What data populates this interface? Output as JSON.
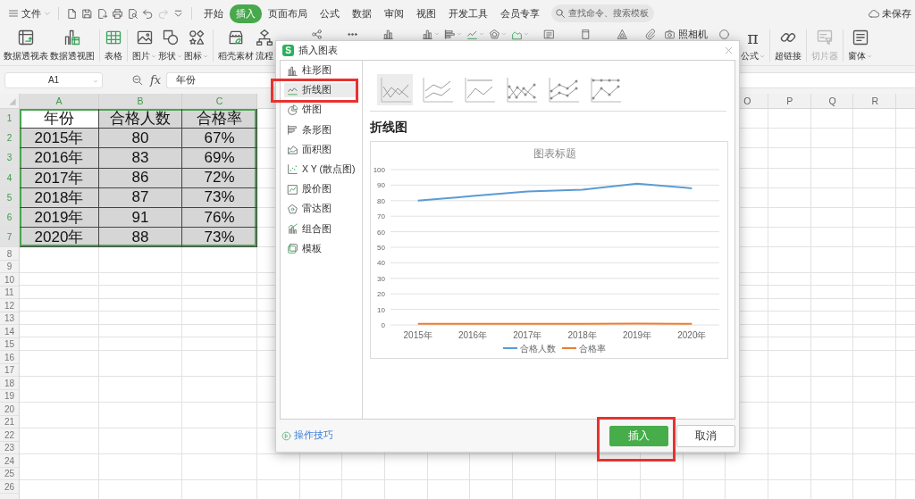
{
  "topbar": {
    "menu_label": "文件",
    "quick_access": [
      {
        "disabled": false
      },
      {
        "disabled": false
      },
      {
        "disabled": false
      },
      {
        "disabled": false
      },
      {
        "disabled": false
      },
      {
        "disabled": false
      },
      {
        "disabled": true
      },
      {
        "disabled": false
      }
    ],
    "tabs": [
      {
        "label": "开始",
        "selected": false
      },
      {
        "label": "插入",
        "selected": true
      },
      {
        "label": "页面布局",
        "selected": false
      },
      {
        "label": "公式",
        "selected": false
      },
      {
        "label": "数据",
        "selected": false
      },
      {
        "label": "审阅",
        "selected": false
      },
      {
        "label": "视图",
        "selected": false
      },
      {
        "label": "开发工具",
        "selected": false
      },
      {
        "label": "会员专享",
        "selected": false
      }
    ],
    "search": {
      "placeholder": "查找命令、搜索模板"
    },
    "save_status": "未保存"
  },
  "ribbon": {
    "tools_left": [
      {
        "label": "数据透视表",
        "dropdown": false
      },
      {
        "label": "数据透视图",
        "dropdown": false
      },
      {
        "label": "表格",
        "dropdown": false
      },
      {
        "label": "图片",
        "dropdown": true
      },
      {
        "label": "形状",
        "dropdown": true
      },
      {
        "label": "图标",
        "dropdown": true
      },
      {
        "label": "稻壳素材",
        "dropdown": false
      },
      {
        "label": "流程",
        "dropdown": false
      }
    ],
    "camera_label": "照相机",
    "tools_right": [
      {
        "label": "公式",
        "glyph": "π",
        "dropdown": true,
        "disabled": false
      },
      {
        "label": "超链接",
        "dropdown": false,
        "disabled": false
      },
      {
        "label": "切片器",
        "dropdown": false,
        "disabled": true
      },
      {
        "label": "窗体",
        "dropdown": true,
        "disabled": false
      }
    ]
  },
  "formula_bar": {
    "cell_ref": "A1",
    "fx_label": "fx",
    "value": "年份"
  },
  "sheet": {
    "columns_left": [
      {
        "label": "A",
        "selected": true
      },
      {
        "label": "B",
        "selected": true
      },
      {
        "label": "C",
        "selected": true
      }
    ],
    "columns_right": [
      {
        "label": "O",
        "selected": false
      },
      {
        "label": "P",
        "selected": false
      },
      {
        "label": "Q",
        "selected": false
      },
      {
        "label": "R",
        "selected": false
      }
    ],
    "rows": [
      {
        "number": "1",
        "selected": true,
        "cells": [
          {
            "text": "年份",
            "active": true
          },
          {
            "text": "合格人数",
            "active": false
          },
          {
            "text": "合格率",
            "active": false
          }
        ]
      },
      {
        "number": "2",
        "selected": true,
        "cells": [
          {
            "text": "2015年",
            "active": false
          },
          {
            "text": "80",
            "active": false
          },
          {
            "text": "67%",
            "active": false
          }
        ]
      },
      {
        "number": "3",
        "selected": true,
        "cells": [
          {
            "text": "2016年",
            "active": false
          },
          {
            "text": "83",
            "active": false
          },
          {
            "text": "69%",
            "active": false
          }
        ]
      },
      {
        "number": "4",
        "selected": true,
        "cells": [
          {
            "text": "2017年",
            "active": false
          },
          {
            "text": "86",
            "active": false
          },
          {
            "text": "72%",
            "active": false
          }
        ]
      },
      {
        "number": "5",
        "selected": true,
        "cells": [
          {
            "text": "2018年",
            "active": false
          },
          {
            "text": "87",
            "active": false
          },
          {
            "text": "73%",
            "active": false
          }
        ]
      },
      {
        "number": "6",
        "selected": true,
        "cells": [
          {
            "text": "2019年",
            "active": false
          },
          {
            "text": "91",
            "active": false
          },
          {
            "text": "76%",
            "active": false
          }
        ]
      },
      {
        "number": "7",
        "selected": true,
        "cells": [
          {
            "text": "2020年",
            "active": false
          },
          {
            "text": "88",
            "active": false
          },
          {
            "text": "73%",
            "active": false
          }
        ]
      },
      {
        "number": "8",
        "selected": false
      },
      {
        "number": "9",
        "selected": false
      },
      {
        "number": "10",
        "selected": false
      },
      {
        "number": "11",
        "selected": false
      },
      {
        "number": "12",
        "selected": false
      },
      {
        "number": "13",
        "selected": false
      },
      {
        "number": "14",
        "selected": false
      },
      {
        "number": "15",
        "selected": false
      },
      {
        "number": "16",
        "selected": false
      },
      {
        "number": "17",
        "selected": false
      },
      {
        "number": "18",
        "selected": false
      },
      {
        "number": "19",
        "selected": false
      },
      {
        "number": "20",
        "selected": false
      },
      {
        "number": "21",
        "selected": false
      },
      {
        "number": "22",
        "selected": false
      },
      {
        "number": "23",
        "selected": false
      },
      {
        "number": "24",
        "selected": false
      },
      {
        "number": "25",
        "selected": false
      },
      {
        "number": "26",
        "selected": false
      }
    ]
  },
  "dialog": {
    "logo_text": "S",
    "title": "插入图表",
    "chart_types": [
      {
        "label": "柱形图",
        "selected": false,
        "highlighted": false
      },
      {
        "label": "折线图",
        "selected": true,
        "highlighted": true
      },
      {
        "label": "饼图",
        "selected": false,
        "highlighted": false
      },
      {
        "label": "条形图",
        "selected": false,
        "highlighted": false
      },
      {
        "label": "面积图",
        "selected": false,
        "highlighted": false
      },
      {
        "label": "X Y (散点图)",
        "selected": false,
        "highlighted": false
      },
      {
        "label": "股价图",
        "selected": false,
        "highlighted": false
      },
      {
        "label": "雷达图",
        "selected": false,
        "highlighted": false
      },
      {
        "label": "组合图",
        "selected": false,
        "highlighted": false
      },
      {
        "label": "模板",
        "selected": false,
        "highlighted": false
      }
    ],
    "subtypes": [
      {
        "selected": true
      },
      {
        "selected": false
      },
      {
        "selected": false
      },
      {
        "selected": false
      },
      {
        "selected": false
      },
      {
        "selected": false
      }
    ],
    "heading": "折线图",
    "chart_data": {
      "type": "line",
      "title": "图表标题",
      "categories": [
        "2015年",
        "2016年",
        "2017年",
        "2018年",
        "2019年",
        "2020年"
      ],
      "series": [
        {
          "name": "合格人数",
          "color": "#5b9bd5",
          "values": [
            80,
            83,
            86,
            87,
            91,
            88
          ]
        },
        {
          "name": "合格率",
          "color": "#ed7d31",
          "values": [
            0.7,
            0.7,
            0.7,
            0.7,
            0.8,
            0.7
          ]
        }
      ],
      "ylim": [
        0,
        100
      ],
      "yticks": [
        0,
        10,
        20,
        30,
        40,
        50,
        60,
        70,
        80,
        90,
        100
      ],
      "grid": true,
      "legend": "bottom"
    },
    "tips_link": "操作技巧",
    "buttons": [
      {
        "label": "插入",
        "kind": "primary",
        "highlighted": true
      },
      {
        "label": "取消",
        "kind": "secondary",
        "highlighted": false
      }
    ]
  }
}
